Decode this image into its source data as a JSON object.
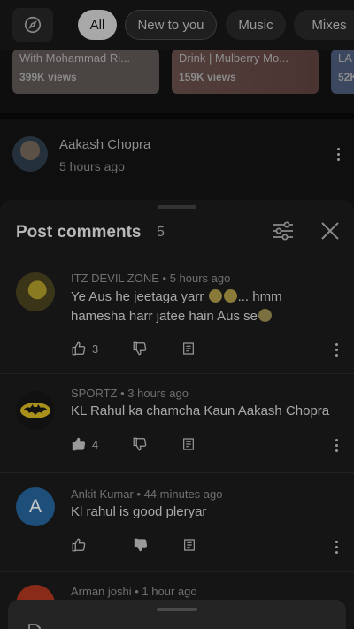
{
  "chips": [
    {
      "label": "All",
      "active": true
    },
    {
      "label": "New to you",
      "active": false
    },
    {
      "label": "Music",
      "active": false
    },
    {
      "label": "Mixes",
      "active": false
    }
  ],
  "cards": [
    {
      "title": "With Mohammad Ri...",
      "views": "399K views"
    },
    {
      "title": "Drink | Mulberry Mo...",
      "views": "159K views"
    },
    {
      "title": "LA",
      "views": "52K"
    }
  ],
  "post": {
    "author": "Aakash Chopra",
    "time": "5 hours ago"
  },
  "comments_sheet": {
    "title": "Post comments",
    "count": "5",
    "comments": [
      {
        "author": "ITZ DEVIL ZONE",
        "time": "5 hours ago",
        "meta": "ITZ DEVIL ZONE • 5 hours ago",
        "text_line1": "Ye Aus he jeetaga yarr",
        "text_line1_tail": "... hmm",
        "text_line2": "hamesha harr jatee hain Aus se",
        "likes": "3"
      },
      {
        "author": "SPORTZ",
        "time": "3 hours ago",
        "meta": "SPORTZ • 3 hours ago",
        "text": "KL Rahul ka chamcha Kaun Aakash Chopra",
        "likes": "4"
      },
      {
        "author": "Ankit Kumar",
        "time": "44 minutes ago",
        "meta": "Ankit Kumar • 44 minutes ago",
        "avatar_letter": "A",
        "text": "Kl rahul is good pleryar",
        "likes": ""
      },
      {
        "author": "Arman joshi",
        "time": "1 hour ago",
        "meta": "Arman joshi • 1 hour ago"
      }
    ]
  },
  "colors": {
    "active_chip": "#a8a8a8",
    "ankit_avatar": "#1e4f7a",
    "arman_avatar": "#8a2a18"
  }
}
